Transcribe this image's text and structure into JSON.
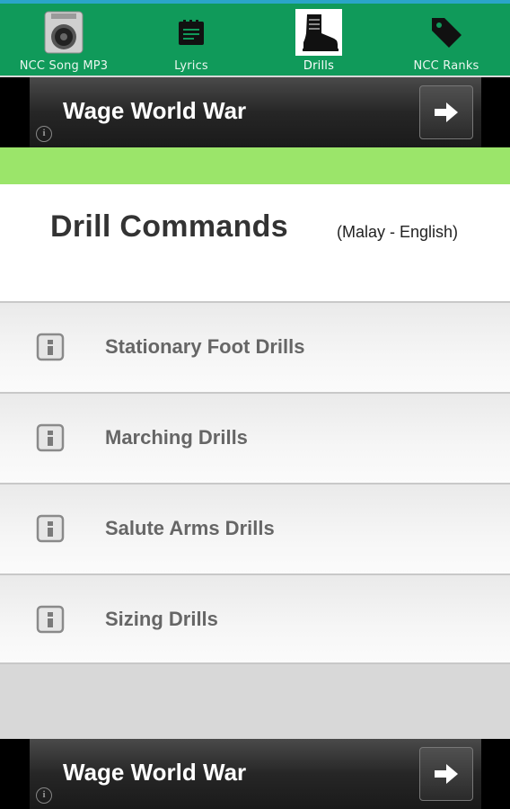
{
  "tabs": [
    {
      "label": "NCC Song MP3",
      "icon": "speaker-icon",
      "selected": false
    },
    {
      "label": "Lyrics",
      "icon": "notes-icon",
      "selected": false
    },
    {
      "label": "Drills",
      "icon": "boot-icon",
      "selected": true
    },
    {
      "label": "NCC Ranks",
      "icon": "tag-icon",
      "selected": false
    }
  ],
  "ad_top": {
    "title": "Wage World War",
    "info": "i"
  },
  "ad_bottom": {
    "title": "Wage World War",
    "info": "i"
  },
  "header": {
    "title": "Drill Commands",
    "subtitle": "(Malay - English)"
  },
  "drills": [
    {
      "label": "Stationary Foot Drills"
    },
    {
      "label": "Marching Drills"
    },
    {
      "label": "Salute Arms Drills"
    },
    {
      "label": "Sizing Drills"
    }
  ],
  "colors": {
    "tabbar": "#109a5a",
    "accent_bar": "#9be56a",
    "topline": "#2aa5c8"
  }
}
